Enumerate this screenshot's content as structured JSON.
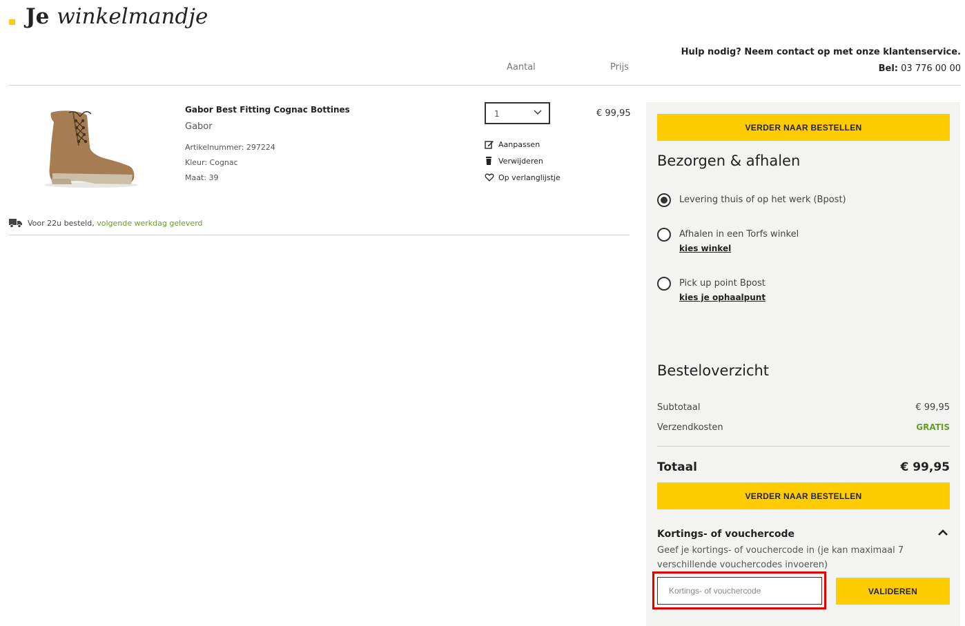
{
  "page": {
    "title_bold": "Je",
    "title_italic": "winkelmandje"
  },
  "help": {
    "line1": "Hulp nodig? Neem contact op met onze klantenservice.",
    "phone_label": "Bel:",
    "phone_number": "03 776 00 00"
  },
  "columns": {
    "quantity": "Aantal",
    "price": "Prijs"
  },
  "product": {
    "name": "Gabor Best Fitting Cognac Bottines",
    "brand": "Gabor",
    "article": "Artikelnummer: 297224",
    "color": "Kleur: Cognac",
    "size": "Maat: 39",
    "quantity": "1",
    "price": "€ 99,95",
    "actions": {
      "edit": "Aanpassen",
      "remove": "Verwijderen",
      "wishlist": "Op verlanglijstje"
    }
  },
  "shipping_note": {
    "prefix": "Voor 22u besteld,",
    "highlight": "volgende werkdag geleverd"
  },
  "sidebar": {
    "checkout_label": "VERDER NAAR BESTELLEN",
    "delivery_heading": "Bezorgen & afhalen",
    "delivery_options": [
      {
        "label": "Levering thuis of op het werk (Bpost)",
        "selected": true,
        "link": ""
      },
      {
        "label": "Afhalen in een Torfs winkel",
        "selected": false,
        "link": "kies winkel"
      },
      {
        "label": "Pick up point Bpost",
        "selected": false,
        "link": "kies je ophaalpunt"
      }
    ],
    "overview_heading": "Besteloverzicht",
    "subtotal_label": "Subtotaal",
    "subtotal_value": "€ 99,95",
    "shipping_label": "Verzendkosten",
    "shipping_value": "GRATIS",
    "total_label": "Totaal",
    "total_value": "€ 99,95",
    "voucher": {
      "heading": "Kortings- of vouchercode",
      "description": "Geef je kortings- of vouchercode in (je kan maximaal 7 verschillende vouchercodes invoeren)",
      "placeholder": "Kortings- of vouchercode",
      "button": "VALIDEREN"
    }
  },
  "colors": {
    "accent": "#ffcc00",
    "green": "#6a9b2e",
    "sidebar_bg": "#f3f3f1",
    "highlight": "#e00000"
  }
}
